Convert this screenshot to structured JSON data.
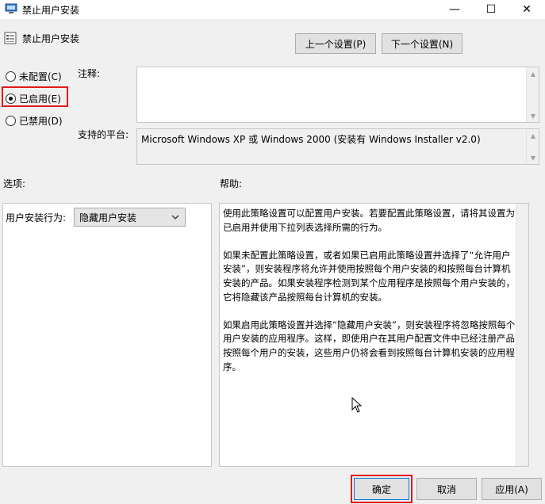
{
  "window": {
    "title": "禁止用户安装",
    "minimize_glyph": "—",
    "maximize_glyph": "☐",
    "close_glyph": "✕"
  },
  "header": {
    "policy_title": "禁止用户安装",
    "prev_button": "上一个设置(P)",
    "next_button": "下一个设置(N)"
  },
  "state": {
    "options": [
      {
        "label": "未配置(C)",
        "checked": false
      },
      {
        "label": "已启用(E)",
        "checked": true
      },
      {
        "label": "已禁用(D)",
        "checked": false
      }
    ]
  },
  "fields": {
    "comment_label": "注释:",
    "comment_value": "",
    "platform_label": "支持的平台:",
    "platform_value": "Microsoft Windows XP 或 Windows 2000 (安装有 Windows Installer v2.0)"
  },
  "options_section": {
    "label": "选项:",
    "install_behavior_label": "用户安装行为:",
    "install_behavior_value": "隐藏用户安装"
  },
  "help_section": {
    "label": "帮助:",
    "text": "使用此策略设置可以配置用户安装。若要配置此策略设置，请将其设置为已启用并使用下拉列表选择所需的行为。\n\n如果未配置此策略设置，或者如果已启用此策略设置并选择了“允许用户安装”，则安装程序将允许并使用按照每个用户安装的和按照每台计算机安装的产品。如果安装程序检测到某个应用程序是按照每个用户安装的，它将隐藏该产品按照每台计算机的安装。\n\n如果启用此策略设置并选择“隐藏用户安装”，则安装程序将忽略按照每个用户安装的应用程序。这样，即使用户在其用户配置文件中已经注册产品按照每个用户的安装，这些用户仍将会看到按照每台计算机安装的应用程序。"
  },
  "footer": {
    "ok_button": "确定",
    "cancel_button": "取消",
    "apply_button": "应用(A)"
  },
  "colors": {
    "highlight": "#e21a1a",
    "focus": "#0078d7"
  }
}
